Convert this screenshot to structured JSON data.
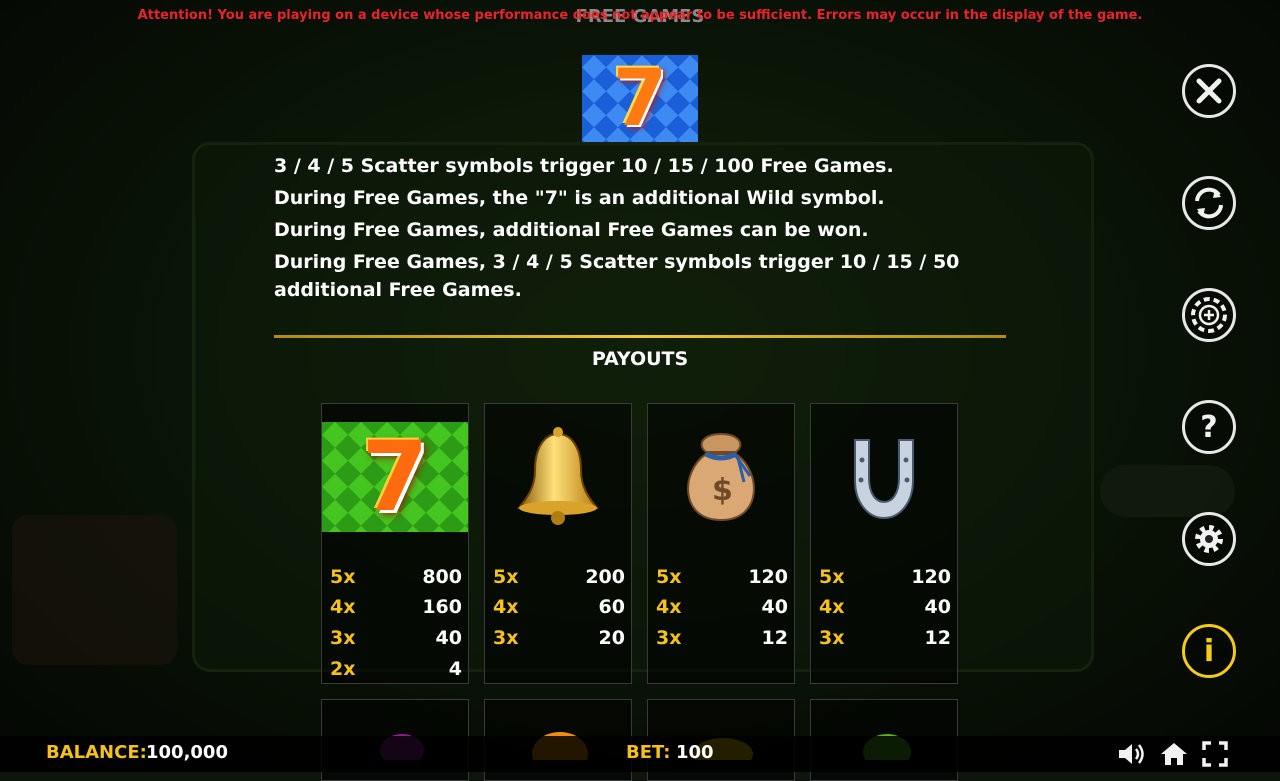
{
  "warning": "Attention! You are playing on a device whose performance does not appear to be sufficient. Errors may occur in the display of the game.",
  "screen_title": "FREE GAMES",
  "rules": [
    "3 / 4 / 5 Scatter symbols trigger 10 / 15 / 100 Free Games.",
    "During Free Games, the \"7\" is an additional Wild symbol.",
    "During Free Games, additional Free Games can be won.",
    "During Free Games, 3 / 4 / 5 Scatter symbols trigger 10 / 15 / 50 additional Free Games."
  ],
  "payouts_title": "PAYOUTS",
  "paytable": [
    {
      "symbol": "seven",
      "rows": [
        {
          "count": "5x",
          "amount": "800"
        },
        {
          "count": "4x",
          "amount": "160"
        },
        {
          "count": "3x",
          "amount": "40"
        },
        {
          "count": "2x",
          "amount": "4"
        }
      ]
    },
    {
      "symbol": "bell",
      "rows": [
        {
          "count": "5x",
          "amount": "200"
        },
        {
          "count": "4x",
          "amount": "60"
        },
        {
          "count": "3x",
          "amount": "20"
        }
      ]
    },
    {
      "symbol": "money-bag",
      "rows": [
        {
          "count": "5x",
          "amount": "120"
        },
        {
          "count": "4x",
          "amount": "40"
        },
        {
          "count": "3x",
          "amount": "12"
        }
      ]
    },
    {
      "symbol": "horseshoe",
      "rows": [
        {
          "count": "5x",
          "amount": "120"
        },
        {
          "count": "4x",
          "amount": "40"
        },
        {
          "count": "3x",
          "amount": "12"
        }
      ]
    }
  ],
  "lower_symbols": [
    "plum",
    "orange",
    "lemon",
    "lime"
  ],
  "seven_glyph": "7",
  "side_buttons": [
    "close-icon",
    "autoplay-icon",
    "bet-chip-icon",
    "help-icon",
    "settings-icon",
    "info-icon"
  ],
  "footer": {
    "balance_label": "BALANCE:",
    "balance_value": "100,000",
    "bet_label": "BET:",
    "bet_value": "100"
  },
  "colors": {
    "accent_gold": "#f4c21a",
    "warning_red": "#e8242b",
    "divider_gold": "#f4c63a"
  }
}
